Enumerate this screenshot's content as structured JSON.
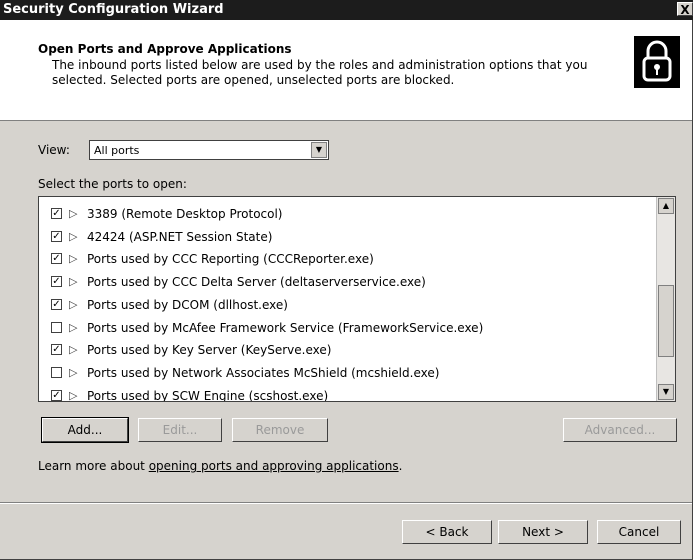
{
  "window": {
    "title": "Security Configuration Wizard",
    "close_glyph": "X"
  },
  "header": {
    "title": "Open Ports and Approve Applications",
    "description": "The inbound ports listed below are used by the roles and administration options that you selected. Selected ports are opened, unselected ports are blocked.",
    "icon": "lock-icon"
  },
  "view": {
    "label": "View:",
    "selected": "All ports"
  },
  "ports_label": "Select the ports to open:",
  "ports": [
    {
      "label": "3389 (Remote Desktop Protocol)",
      "checked": true
    },
    {
      "label": "42424 (ASP.NET Session State)",
      "checked": true
    },
    {
      "label": "Ports used by CCC Reporting (CCCReporter.exe)",
      "checked": true
    },
    {
      "label": "Ports used by CCC Delta Server (deltaserverservice.exe)",
      "checked": true
    },
    {
      "label": "Ports used by DCOM (dllhost.exe)",
      "checked": true
    },
    {
      "label": "Ports used by McAfee Framework Service (FrameworkService.exe)",
      "checked": false
    },
    {
      "label": "Ports used by Key Server (KeyServe.exe)",
      "checked": true
    },
    {
      "label": "Ports used by Network Associates McShield (mcshield.exe)",
      "checked": false
    },
    {
      "label": "Ports used by SCW Engine (scshost.exe)",
      "checked": true
    }
  ],
  "buttons": {
    "add": "Add...",
    "edit": "Edit...",
    "remove": "Remove",
    "advanced": "Advanced..."
  },
  "learn_more": {
    "prefix": "Learn more about ",
    "link": "opening ports and approving applications",
    "suffix": "."
  },
  "nav": {
    "back": "< Back",
    "next": "Next >",
    "cancel": "Cancel"
  },
  "check_glyph": "✓"
}
